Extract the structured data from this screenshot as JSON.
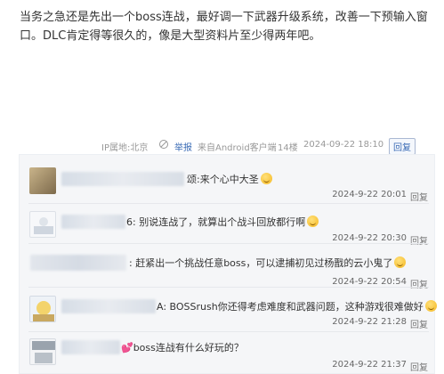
{
  "post": {
    "text": "当务之急还是先出一个boss连战，最好调一下武器升级系统，改善一下预输入窗口。DLC肯定得等很久的，像是大型资料片至少得两年吧。"
  },
  "meta": {
    "location": "IP属地:北京",
    "report": "举报",
    "source": "来自Android客户端",
    "floor": "14楼",
    "time": "2024-09-22 18:10",
    "reply": "回复"
  },
  "comments": [
    {
      "text": "颂:来个心中大圣",
      "time": "2024-9-22 20:01",
      "reply": "回复"
    },
    {
      "text": "6: 别说连战了，就算出个战斗回放都行啊",
      "time": "2024-9-22 20:30",
      "reply": "回复"
    },
    {
      "text": ": 赶紧出一个挑战任意boss，可以逮捕初见过杨戬的云小鬼了",
      "time": "2024-9-22 20:54",
      "reply": "回复"
    },
    {
      "text": "A: BOSSrush你还得考虑难度和武器问题，这种游戏很难做好",
      "time": "2024-9-22 21:28",
      "reply": "回复"
    },
    {
      "text": "boss连战有什么好玩的？",
      "time": "2024-9-22 21:37",
      "reply": "回复"
    }
  ]
}
